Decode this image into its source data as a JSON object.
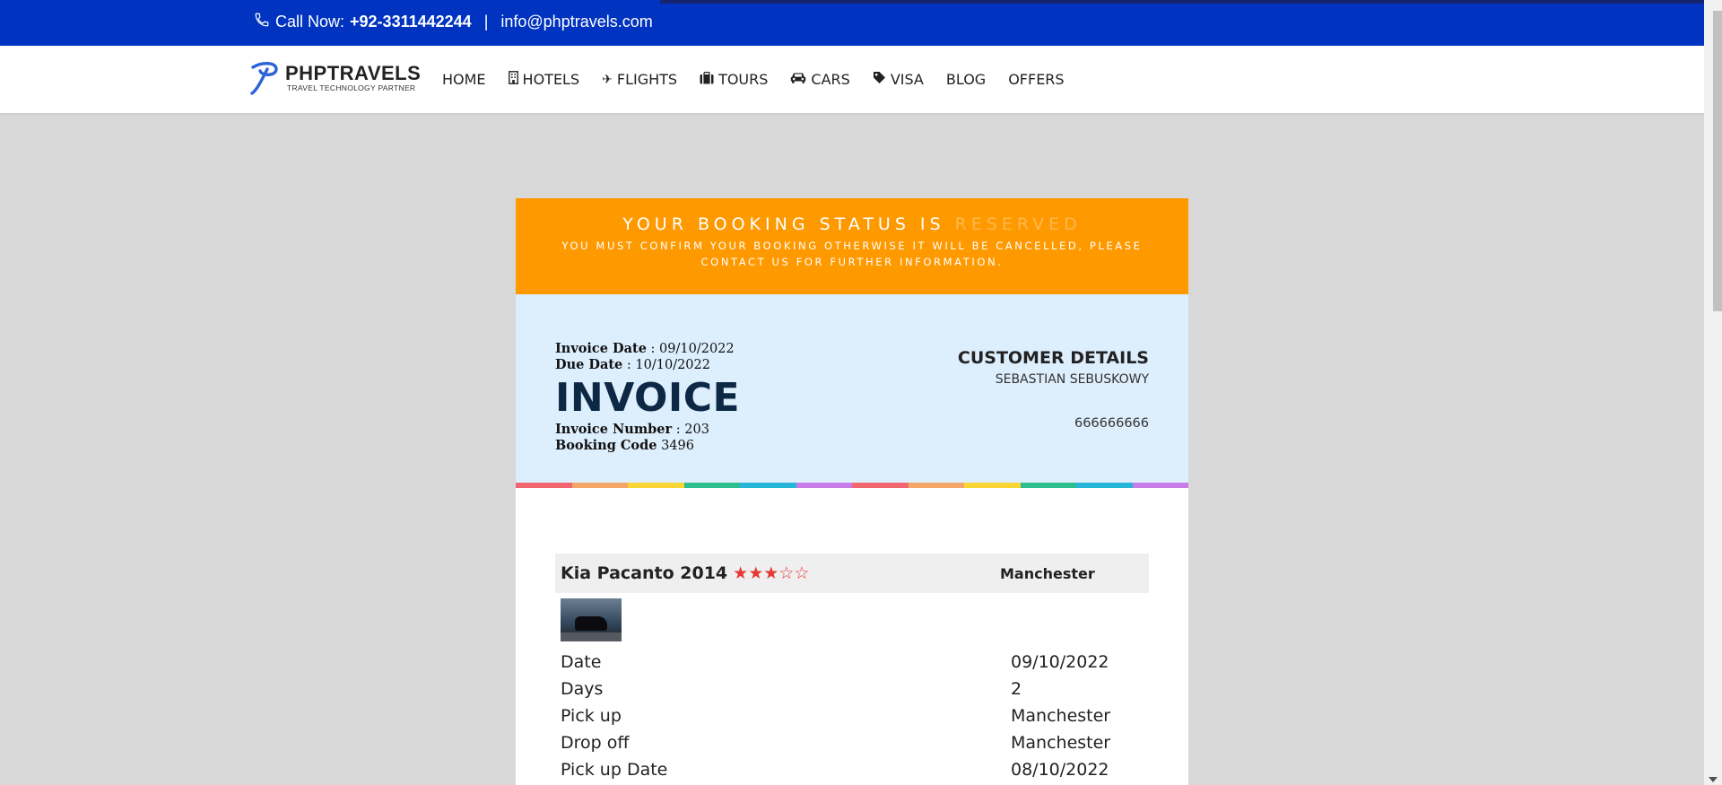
{
  "topbar": {
    "call_prefix": "Call Now:",
    "phone": "+92-3311442244",
    "separator": "|",
    "email": "info@phptravels.com"
  },
  "brand": {
    "name": "PHPTRAVELS",
    "tagline": "TRAVEL TECHNOLOGY PARTNER",
    "color": "#2b63d8"
  },
  "nav": [
    {
      "label": "HOME",
      "icon": ""
    },
    {
      "label": "HOTELS",
      "icon": "building-icon"
    },
    {
      "label": "FLIGHTS",
      "icon": "plane-icon"
    },
    {
      "label": "TOURS",
      "icon": "suitcase-icon"
    },
    {
      "label": "CARS",
      "icon": "car-icon"
    },
    {
      "label": "VISA",
      "icon": "tag-icon"
    },
    {
      "label": "BLOG",
      "icon": ""
    },
    {
      "label": "OFFERS",
      "icon": ""
    }
  ],
  "banner": {
    "status_prefix": "YOUR BOOKING STATUS IS",
    "status": "RESERVED",
    "message": "YOU MUST CONFIRM YOUR BOOKING OTHERWISE IT WILL BE CANCELLED, PLEASE CONTACT US FOR FURTHER INFORMATION.",
    "color": "#ff9900"
  },
  "invoice": {
    "date_label": "Invoice Date",
    "date": "09/10/2022",
    "due_label": "Due Date",
    "due": "10/10/2022",
    "title": "INVOICE",
    "number_label": "Invoice Number",
    "number": "203",
    "booking_label": "Booking Code",
    "booking": "3496"
  },
  "customer": {
    "heading": "CUSTOMER DETAILS",
    "name": "SEBASTIAN SEBUSKOWY",
    "phone": "666666666"
  },
  "rainbow_colors": [
    "#f2676f",
    "#f3a76b",
    "#f9d535",
    "#2dbd8e",
    "#26b7d8",
    "#c87ce8",
    "#f2676f",
    "#f3a76b",
    "#f9d535",
    "#2dbd8e",
    "#26b7d8",
    "#c87ce8"
  ],
  "item": {
    "title": "Kia Pacanto 2014",
    "rating": 3,
    "rating_max": 5,
    "location": "Manchester",
    "thumbnail": "car-photo"
  },
  "details": [
    {
      "label": "Date",
      "value": "09/10/2022"
    },
    {
      "label": "Days",
      "value": "2"
    },
    {
      "label": "Pick up",
      "value": "Manchester"
    },
    {
      "label": "Drop off",
      "value": "Manchester"
    },
    {
      "label": "Pick up Date",
      "value": "08/10/2022"
    }
  ]
}
